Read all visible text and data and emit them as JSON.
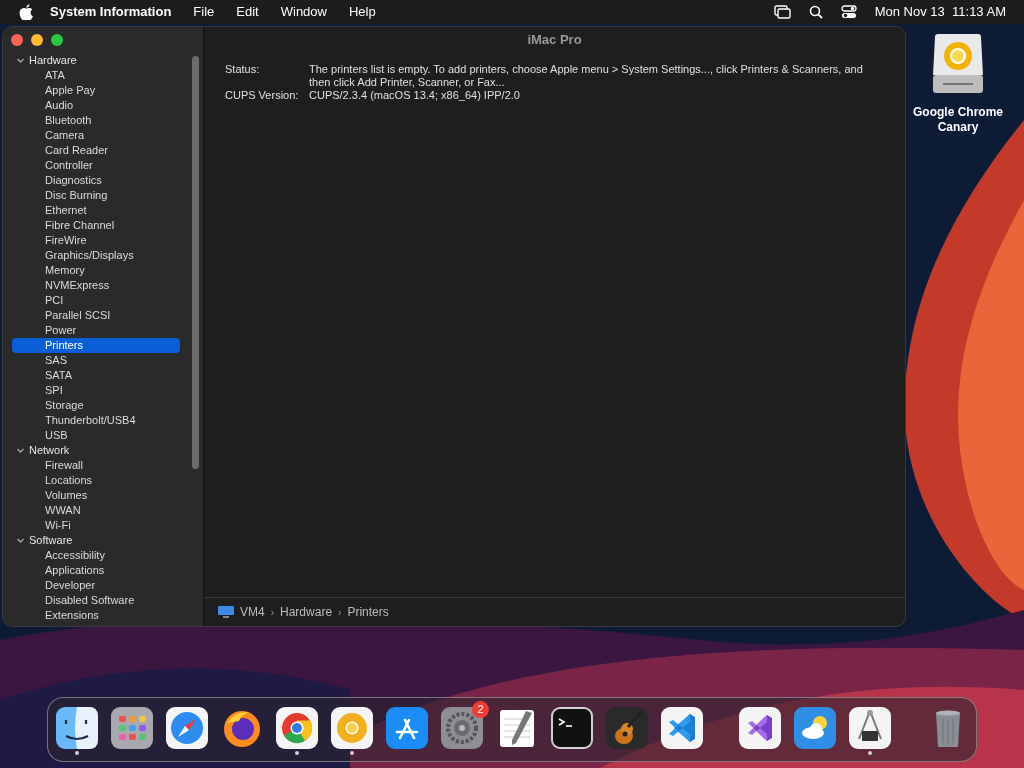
{
  "menu_bar": {
    "app": "System Information",
    "menus": [
      "File",
      "Edit",
      "Window",
      "Help"
    ],
    "clock": "Mon Nov 13  11:13 AM"
  },
  "window": {
    "title": "iMac Pro"
  },
  "sidebar": [
    {
      "label": "Hardware",
      "expanded": true,
      "children": [
        {
          "label": "ATA",
          "selected": false
        },
        {
          "label": "Apple Pay",
          "selected": false
        },
        {
          "label": "Audio",
          "selected": false
        },
        {
          "label": "Bluetooth",
          "selected": false
        },
        {
          "label": "Camera",
          "selected": false
        },
        {
          "label": "Card Reader",
          "selected": false
        },
        {
          "label": "Controller",
          "selected": false
        },
        {
          "label": "Diagnostics",
          "selected": false
        },
        {
          "label": "Disc Burning",
          "selected": false
        },
        {
          "label": "Ethernet",
          "selected": false
        },
        {
          "label": "Fibre Channel",
          "selected": false
        },
        {
          "label": "FireWire",
          "selected": false
        },
        {
          "label": "Graphics/Displays",
          "selected": false
        },
        {
          "label": "Memory",
          "selected": false
        },
        {
          "label": "NVMExpress",
          "selected": false
        },
        {
          "label": "PCI",
          "selected": false
        },
        {
          "label": "Parallel SCSI",
          "selected": false
        },
        {
          "label": "Power",
          "selected": false
        },
        {
          "label": "Printers",
          "selected": true
        },
        {
          "label": "SAS",
          "selected": false
        },
        {
          "label": "SATA",
          "selected": false
        },
        {
          "label": "SPI",
          "selected": false
        },
        {
          "label": "Storage",
          "selected": false
        },
        {
          "label": "Thunderbolt/USB4",
          "selected": false
        },
        {
          "label": "USB",
          "selected": false
        }
      ]
    },
    {
      "label": "Network",
      "expanded": true,
      "children": [
        {
          "label": "Firewall",
          "selected": false
        },
        {
          "label": "Locations",
          "selected": false
        },
        {
          "label": "Volumes",
          "selected": false
        },
        {
          "label": "WWAN",
          "selected": false
        },
        {
          "label": "Wi-Fi",
          "selected": false
        }
      ]
    },
    {
      "label": "Software",
      "expanded": true,
      "children": [
        {
          "label": "Accessibility",
          "selected": false
        },
        {
          "label": "Applications",
          "selected": false
        },
        {
          "label": "Developer",
          "selected": false
        },
        {
          "label": "Disabled Software",
          "selected": false
        },
        {
          "label": "Extensions",
          "selected": false
        }
      ]
    }
  ],
  "details": [
    {
      "label": "Status:",
      "value": "The printers list is empty. To add printers, choose Apple menu > System Settings..., click Printers & Scanners, and then click Add Printer, Scanner, or Fax..."
    },
    {
      "label": "CUPS Version:",
      "value": "CUPS/2.3.4 (macOS 13.4; x86_64) IPP/2.0"
    }
  ],
  "breadcrumb": {
    "separator": "›",
    "items": [
      "VM4",
      "Hardware",
      "Printers"
    ]
  },
  "desktop_icon": {
    "label": "Google Chrome Canary"
  },
  "dock": [
    {
      "kind": "finder",
      "running": true
    },
    {
      "kind": "launchpad",
      "running": false
    },
    {
      "kind": "safari",
      "running": false
    },
    {
      "kind": "firefox",
      "running": false
    },
    {
      "kind": "chrome",
      "running": true
    },
    {
      "kind": "canary",
      "running": true
    },
    {
      "kind": "appstore",
      "running": false
    },
    {
      "kind": "settings",
      "running": false,
      "badge": "2"
    },
    {
      "kind": "textedit",
      "running": false
    },
    {
      "kind": "terminal",
      "running": false
    },
    {
      "kind": "garageband",
      "running": false
    },
    {
      "kind": "vscode",
      "running": false
    },
    {
      "kind": "separator"
    },
    {
      "kind": "visualstudio",
      "running": false
    },
    {
      "kind": "weather",
      "running": false
    },
    {
      "kind": "instruments",
      "running": true
    },
    {
      "kind": "separator"
    },
    {
      "kind": "trash",
      "running": false
    }
  ]
}
